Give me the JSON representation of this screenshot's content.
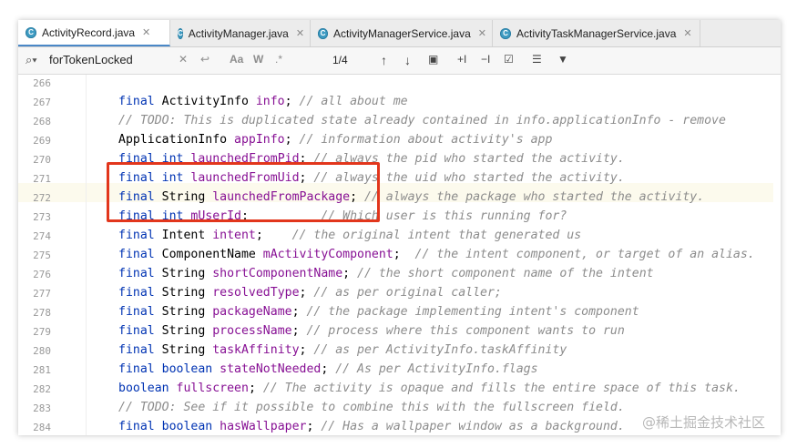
{
  "tabs": [
    {
      "label": "ActivityRecord.java",
      "active": true
    },
    {
      "label": "ActivityManager.java",
      "active": false
    },
    {
      "label": "ActivityManagerService.java",
      "active": false
    },
    {
      "label": "ActivityTaskManagerService.java",
      "active": false
    }
  ],
  "search": {
    "query": "forTokenLocked",
    "match_count": "1/4",
    "case_label": "Aa",
    "words_label": "W",
    "regex_label": ".*"
  },
  "code_lines": [
    {
      "n": "266"
    },
    {
      "n": "267"
    },
    {
      "n": "268"
    },
    {
      "n": "269"
    },
    {
      "n": "270"
    },
    {
      "n": "271"
    },
    {
      "n": "272"
    },
    {
      "n": "273"
    },
    {
      "n": "274"
    },
    {
      "n": "275"
    },
    {
      "n": "276"
    },
    {
      "n": "277"
    },
    {
      "n": "278"
    },
    {
      "n": "279"
    },
    {
      "n": "280"
    },
    {
      "n": "281"
    },
    {
      "n": "282"
    },
    {
      "n": "283"
    },
    {
      "n": "284"
    }
  ],
  "code": {
    "l267": {
      "a": "final",
      "b": " ActivityInfo ",
      "c": "info",
      "d": "; ",
      "e": "// all about me"
    },
    "l268": {
      "e": "// TODO: This is duplicated state already contained in info.applicationInfo - remove"
    },
    "l269": {
      "b": "ApplicationInfo ",
      "c": "appInfo",
      "d": "; ",
      "e": "// information about activity's app"
    },
    "l270": {
      "a": "final int",
      "c": "launchedFromPid",
      "d": "; ",
      "e": "// always the pid who started the activity."
    },
    "l271": {
      "a": "final int",
      "c": "launchedFromUid",
      "d": "; ",
      "e": "// always the uid who started the activity."
    },
    "l272": {
      "a": "final",
      "b": " String ",
      "c": "launchedFromPackage",
      "d": "; ",
      "e": "// always the package who started the activity."
    },
    "l273": {
      "a": "final int",
      "c": "mUserId",
      "d": ";          ",
      "e": "// Which user is this running for?"
    },
    "l274": {
      "a": "final",
      "b": " Intent ",
      "c": "intent",
      "d": ";    ",
      "e": "// the original intent that generated us"
    },
    "l275": {
      "a": "final",
      "b": " ComponentName ",
      "c": "mActivityComponent",
      "d": ";  ",
      "e": "// the intent component, or target of an alias."
    },
    "l276": {
      "a": "final",
      "b": " String ",
      "c": "shortComponentName",
      "d": "; ",
      "e": "// the short component name of the intent"
    },
    "l277": {
      "a": "final",
      "b": " String ",
      "c": "resolvedType",
      "d": "; ",
      "e": "// as per original caller;"
    },
    "l278": {
      "a": "final",
      "b": " String ",
      "c": "packageName",
      "d": "; ",
      "e": "// the package implementing intent's component"
    },
    "l279": {
      "a": "final",
      "b": " String ",
      "c": "processName",
      "d": "; ",
      "e": "// process where this component wants to run"
    },
    "l280": {
      "a": "final",
      "b": " String ",
      "c": "taskAffinity",
      "d": "; ",
      "e": "// as per ActivityInfo.taskAffinity"
    },
    "l281": {
      "a": "final boolean",
      "c": "stateNotNeeded",
      "d": "; ",
      "e": "// As per ActivityInfo.flags"
    },
    "l282": {
      "a": "boolean",
      "c": "fullscreen",
      "d": "; ",
      "e": "// The activity is opaque and fills the entire space of this task."
    },
    "l283": {
      "e": "// TODO: See if it possible to combine this with the fullscreen field."
    },
    "l284": {
      "a": "final boolean",
      "c": "hasWallpaper",
      "d": "; ",
      "e": "// Has a wallpaper window as a background."
    }
  },
  "watermark": "@稀土掘金技术社区",
  "colors": {
    "keyword": "#0033b3",
    "field": "#871094",
    "comment": "#8c8c8c",
    "highlight_box": "#e2361c",
    "caret_line": "#fcfaed"
  }
}
